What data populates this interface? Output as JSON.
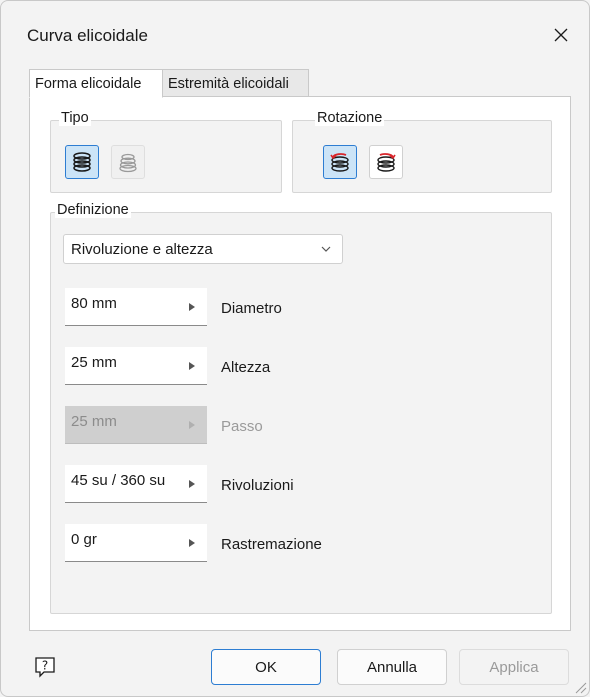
{
  "window": {
    "title": "Curva elicoidale"
  },
  "tabs": [
    {
      "label": "Forma elicoidale",
      "active": true
    },
    {
      "label": "Estremità elicoidali",
      "active": false
    }
  ],
  "tipo": {
    "label": "Tipo",
    "buttons": [
      {
        "icon": "helix-coil-icon",
        "selected": true
      },
      {
        "icon": "spiral-coil-icon",
        "selected": false,
        "disabled": true
      }
    ]
  },
  "rotazione": {
    "label": "Rotazione",
    "buttons": [
      {
        "icon": "rotation-clockwise-icon",
        "selected": true
      },
      {
        "icon": "rotation-counterclockwise-icon",
        "selected": false
      }
    ]
  },
  "definizione": {
    "label": "Definizione",
    "method": "Rivoluzione e altezza",
    "fields": [
      {
        "value": "80 mm",
        "label": "Diametro",
        "disabled": false
      },
      {
        "value": "25 mm",
        "label": "Altezza",
        "disabled": false
      },
      {
        "value": "25 mm",
        "label": "Passo",
        "disabled": true
      },
      {
        "value": "45 su / 360 su",
        "label": "Rivoluzioni",
        "disabled": false
      },
      {
        "value": "0 gr",
        "label": "Rastremazione",
        "disabled": false
      }
    ]
  },
  "footer": {
    "help_icon": "help-icon",
    "ok": "OK",
    "cancel": "Annulla",
    "apply": "Applica"
  },
  "colors": {
    "accent": "#2d7dd2",
    "selected_bg": "#cce4f7",
    "rotation_red": "#d9262c"
  }
}
